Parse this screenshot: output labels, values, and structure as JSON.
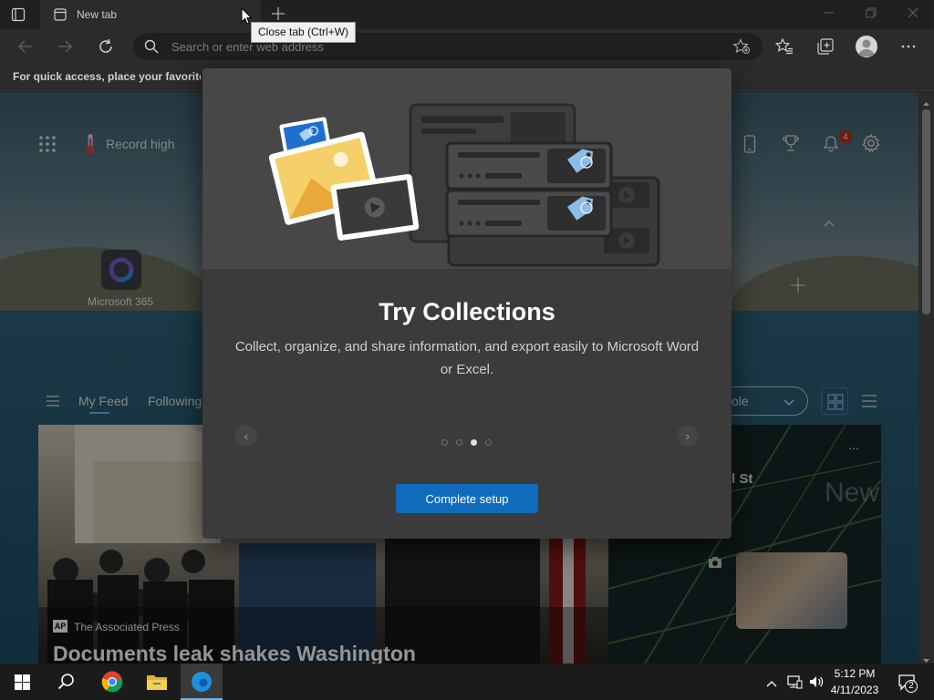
{
  "browser": {
    "tab_title": "New tab",
    "address_placeholder": "Search or enter web address",
    "favorites_prompt": "For quick access, place your favorites here on the favorites bar.",
    "tooltip": "Close tab (Ctrl+W)"
  },
  "newtab": {
    "weather": "Record high",
    "notification_count": "4",
    "quick_link": "Microsoft 365",
    "feed_tabs": [
      "My Feed",
      "Following"
    ],
    "layout_select": "ole",
    "news_right_heading": "l St",
    "news_right_new": "New",
    "news_source": "The Associated Press",
    "news_source_badge": "AP",
    "news_headline": "Documents leak shakes Washington",
    "more": "..."
  },
  "modal": {
    "title": "Try Collections",
    "description": "Collect, organize, and share information, and export easily to Microsoft Word or Excel.",
    "button": "Complete setup",
    "slides": 4,
    "active_slide": 3
  },
  "taskbar": {
    "time": "5:12 PM",
    "date": "4/11/2023",
    "notifications": "2"
  },
  "colors": {
    "accent": "#0f6cbd",
    "modal_bg": "#3b3b3b",
    "badge": "#c42b1c"
  }
}
